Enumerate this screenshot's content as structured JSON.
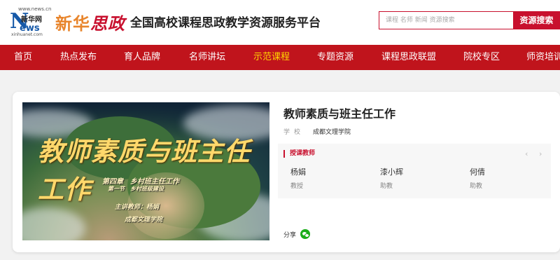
{
  "header": {
    "logo_news_url": "www.news.cn",
    "logo_news_cn": "新华网",
    "logo_news_n": "N",
    "logo_news_ews": "ews",
    "logo_news_url2": "xinhuanet.com",
    "logo_xhsz_1": "新华",
    "logo_xhsz_2": "思政",
    "platform_title": "全国高校课程思政教学资源服务平台",
    "search_placeholder": "课程 名师 新闻 资源搜索",
    "search_button": "资源搜索"
  },
  "nav": {
    "items": [
      {
        "label": "首页",
        "active": false
      },
      {
        "label": "热点发布",
        "active": false
      },
      {
        "label": "育人品牌",
        "active": false
      },
      {
        "label": "名师讲坛",
        "active": false
      },
      {
        "label": "示范课程",
        "active": true
      },
      {
        "label": "专题资源",
        "active": false
      },
      {
        "label": "课程思政联盟",
        "active": false
      },
      {
        "label": "院校专区",
        "active": false
      },
      {
        "label": "师资培训",
        "active": false
      }
    ]
  },
  "course": {
    "title": "教师素质与班主任工作",
    "school_label": "学校",
    "school_value": "成都文理学院",
    "thumbnail": {
      "title": "教师素质与班主任工作",
      "chapter": "第四章　乡村班主任工作",
      "section": "第一节　乡村班级建设",
      "lecturer": "主讲教师：杨娟",
      "institution": "成都文理学院"
    },
    "teachers_heading": "授课教师",
    "prev_arrow": "‹",
    "next_arrow": "›",
    "teachers": [
      {
        "name": "杨娟",
        "title": "教授"
      },
      {
        "name": "漆小辉",
        "title": "助教"
      },
      {
        "name": "何倩",
        "title": "助教"
      }
    ],
    "share_label": "分享"
  },
  "colors": {
    "brand_red": "#c0141c",
    "active_nav": "#ffd700",
    "wechat_green": "#1aad19"
  },
  "icons": [
    "wechat-icon",
    "chevron-left-icon",
    "chevron-right-icon"
  ]
}
